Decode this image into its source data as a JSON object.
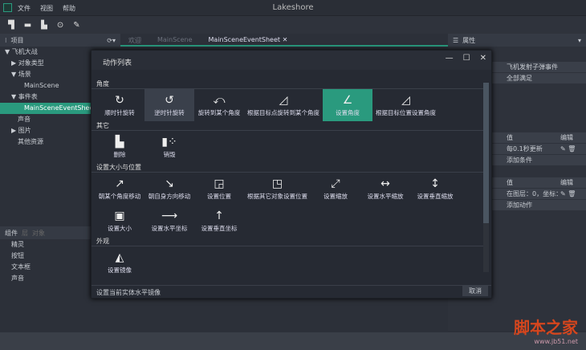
{
  "app": {
    "title": "Lakeshore",
    "menu": [
      "文件",
      "视图",
      "帮助"
    ]
  },
  "toolbar": {
    "icons": [
      "new-icon",
      "open-icon",
      "save-icon",
      "play-icon",
      "publish-icon"
    ]
  },
  "project": {
    "header": "项目",
    "items": [
      {
        "label": "▼ 飞机大战",
        "indent": 0
      },
      {
        "label": "▶ 对象类型",
        "indent": 1
      },
      {
        "label": "▼ 场景",
        "indent": 1
      },
      {
        "label": "MainScene",
        "indent": 3
      },
      {
        "label": "▼ 事件表",
        "indent": 1
      },
      {
        "label": "MainSceneEventSheet",
        "indent": 3,
        "selected": true
      },
      {
        "label": "声音",
        "indent": 2
      },
      {
        "label": "▶ 图片",
        "indent": 1
      },
      {
        "label": "其他资源",
        "indent": 2
      }
    ]
  },
  "tabs": [
    {
      "label": "欢迎"
    },
    {
      "label": "MainScene"
    },
    {
      "label": "MainSceneEventSheet",
      "active": true
    }
  ],
  "components": {
    "tabs": [
      "组件",
      "层",
      "对象"
    ],
    "items": [
      "精灵",
      "按钮",
      "文本框",
      "声音"
    ]
  },
  "properties": {
    "header": "属性",
    "event_name": "飞机发射子弹事件",
    "condition_mode": "全部满足",
    "cond_table": {
      "col_value": "值",
      "col_edit": "编辑",
      "row": "每0.1秒更新",
      "add": "添加条件"
    },
    "action_table": {
      "col_value": "值",
      "col_edit": "编辑",
      "row": "在图层：0，坐标：",
      "add": "添加动作"
    }
  },
  "dialog": {
    "title": "动作列表",
    "sections": [
      {
        "title": "角度",
        "items": [
          {
            "label": "顺时针旋转",
            "icon": "↻"
          },
          {
            "label": "逆时针旋转",
            "icon": "↺",
            "state": "hover"
          },
          {
            "label": "旋转到某个角度",
            "icon": "⤺"
          },
          {
            "label": "根据目标点旋转到某个角度",
            "icon": "◿"
          },
          {
            "label": "设置角度",
            "icon": "∠",
            "state": "selected"
          },
          {
            "label": "根据目标位置设置角度",
            "icon": "◿"
          }
        ]
      },
      {
        "title": "其它",
        "items": [
          {
            "label": "删除",
            "icon": "▙"
          },
          {
            "label": "销毁",
            "icon": "▮⁘"
          }
        ]
      },
      {
        "title": "设置大小与位置",
        "items": [
          {
            "label": "朝某个角度移动",
            "icon": "↗"
          },
          {
            "label": "朝自身方向移动",
            "icon": "↘"
          },
          {
            "label": "设置位置",
            "icon": "◲"
          },
          {
            "label": "根据其它对象设置位置",
            "icon": "◳"
          },
          {
            "label": "设置缩放",
            "icon": "⤢"
          },
          {
            "label": "设置水平缩放",
            "icon": "↔"
          },
          {
            "label": "设置垂直缩放",
            "icon": "↕"
          },
          {
            "label": "设置大小",
            "icon": "▣"
          },
          {
            "label": "设置水平坐标",
            "icon": "⟶"
          },
          {
            "label": "设置垂直坐标",
            "icon": "↑"
          }
        ]
      },
      {
        "title": "外观",
        "items": [
          {
            "label": "设置镜像",
            "icon": "◭"
          }
        ]
      }
    ],
    "description": "设置当前实体水平镜像",
    "cancel": "取消"
  },
  "watermark": {
    "text": "脚本之家",
    "url": "www.jb51.net"
  },
  "colors": {
    "accent": "#2a9a7e",
    "bg": "#2c3039"
  }
}
